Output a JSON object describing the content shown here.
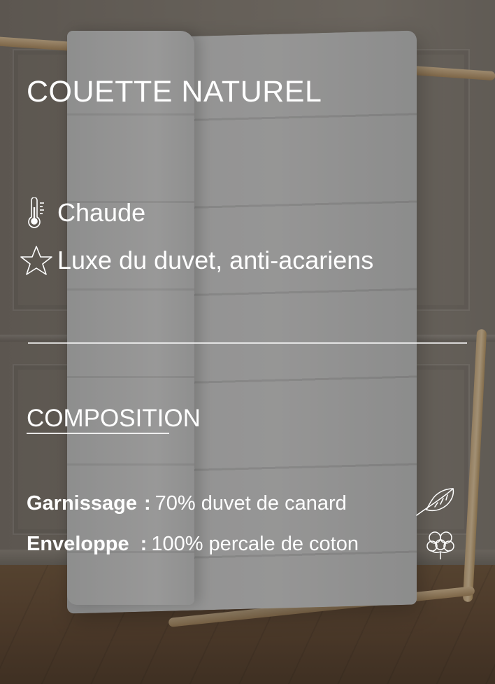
{
  "product": {
    "title": "COUETTE NATUREL"
  },
  "features": [
    {
      "icon": "thermometer-icon",
      "label": "Chaude"
    },
    {
      "icon": "star-icon",
      "label": "Luxe du duvet, anti-acariens"
    }
  ],
  "composition": {
    "heading": "COMPOSITION",
    "rows": [
      {
        "label": "Garnissage",
        "separator": ":",
        "value": "70% duvet de canard",
        "icon": "feather-icon"
      },
      {
        "label": "Enveloppe",
        "separator": ":",
        "value": "100% percale de coton",
        "icon": "cotton-flower-icon"
      }
    ]
  },
  "colors": {
    "text": "#ffffff",
    "overlay": "#282624"
  }
}
